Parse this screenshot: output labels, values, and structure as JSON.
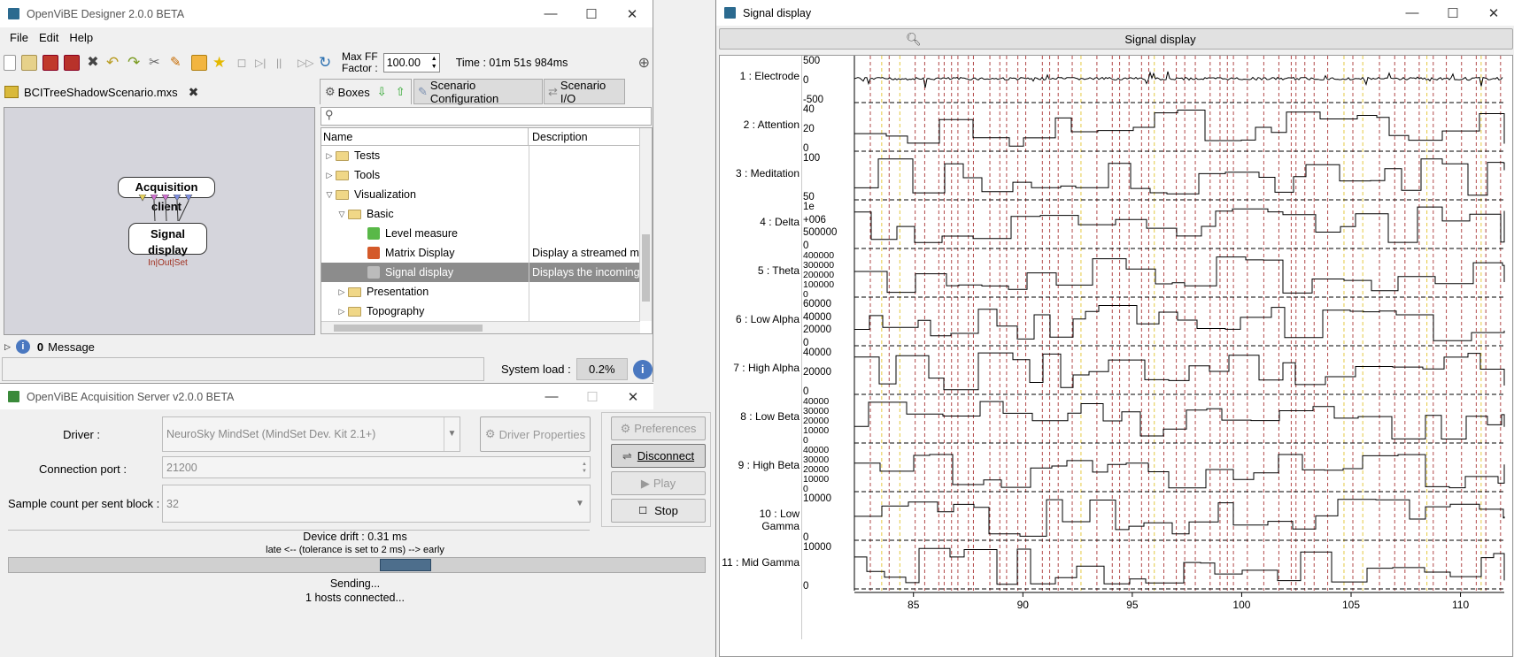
{
  "designer": {
    "title": "OpenViBE Designer 2.0.0 BETA",
    "menu": [
      "File",
      "Edit",
      "Help"
    ],
    "maxff_label1": "Max FF",
    "maxff_label2": "Factor :",
    "maxff_value": "100.00",
    "time": "Time : 01m 51s 984ms",
    "scenario_tab": "BCITreeShadowScenario.mxs",
    "box_acq": "Acquisition client",
    "box_sig": "Signal display",
    "box_sig_sub": "In|Out|Set",
    "tabs": [
      "Boxes",
      "Scenario Configuration",
      "Scenario I/O"
    ],
    "col_name": "Name",
    "col_desc": "Description",
    "tree": [
      {
        "label": "Tests",
        "level": 0,
        "arrow": "▷",
        "folder": true,
        "desc": ""
      },
      {
        "label": "Tools",
        "level": 0,
        "arrow": "▷",
        "folder": true,
        "desc": ""
      },
      {
        "label": "Visualization",
        "level": 0,
        "arrow": "▽",
        "folder": true,
        "desc": ""
      },
      {
        "label": "Basic",
        "level": 1,
        "arrow": "▽",
        "folder": true,
        "desc": ""
      },
      {
        "label": "Level measure",
        "level": 2,
        "arrow": "",
        "folder": false,
        "desc": ""
      },
      {
        "label": "Matrix Display",
        "level": 2,
        "arrow": "",
        "folder": false,
        "desc": "Display a streamed ma"
      },
      {
        "label": "Signal display",
        "level": 2,
        "arrow": "",
        "folder": false,
        "desc": "Displays the incoming s",
        "selected": true
      },
      {
        "label": "Presentation",
        "level": 1,
        "arrow": "▷",
        "folder": true,
        "desc": ""
      },
      {
        "label": "Topography",
        "level": 1,
        "arrow": "▷",
        "folder": true,
        "desc": ""
      }
    ],
    "message_count": "0",
    "message_label": "Message",
    "sysload_label": "System load :",
    "sysload_value": "0.2%"
  },
  "acq": {
    "title": "OpenViBE Acquisition Server v2.0.0 BETA",
    "driver_label": "Driver :",
    "driver_value": "NeuroSky MindSet (MindSet Dev. Kit 2.1+)",
    "driver_props": "Driver Properties",
    "port_label": "Connection port :",
    "port_value": "21200",
    "sample_label": "Sample count per sent block :",
    "sample_value": "32",
    "preferences": "Preferences",
    "disconnect": "Disconnect",
    "play": "Play",
    "stop": "Stop",
    "drift": "Device drift : 0.31 ms",
    "tolerance": "late <-- (tolerance is set to 2 ms) --> early",
    "drift_fraction": 0.57,
    "status1": "Sending...",
    "status2": "1 hosts connected..."
  },
  "signal": {
    "title": "Signal display",
    "button": "Signal display",
    "channels": [
      {
        "label": "1 : Electrode",
        "ticks": [
          "500",
          "0",
          "-500"
        ]
      },
      {
        "label": "2 : Attention",
        "ticks": [
          "40",
          "20",
          "0"
        ]
      },
      {
        "label": "3 : Meditation",
        "ticks": [
          "100",
          "50"
        ]
      },
      {
        "label": "4 : Delta",
        "ticks": [
          "1e",
          "+006",
          "500000",
          "0"
        ]
      },
      {
        "label": "5 : Theta",
        "ticks": [
          "400000",
          "300000",
          "200000",
          "100000",
          "0"
        ]
      },
      {
        "label": "6 : Low Alpha",
        "ticks": [
          "60000",
          "40000",
          "20000",
          "0"
        ]
      },
      {
        "label": "7 : High Alpha",
        "ticks": [
          "40000",
          "20000",
          "0"
        ]
      },
      {
        "label": "8 : Low Beta",
        "ticks": [
          "40000",
          "30000",
          "20000",
          "10000",
          "0"
        ]
      },
      {
        "label": "9 : High Beta",
        "ticks": [
          "40000",
          "30000",
          "20000",
          "10000",
          "0"
        ]
      },
      {
        "label": "10 : Low Gamma",
        "ticks": [
          "10000",
          "0"
        ]
      },
      {
        "label": "11 : Mid Gamma",
        "ticks": [
          "10000",
          "0"
        ]
      }
    ],
    "x_ticks": [
      "85",
      "90",
      "95",
      "100",
      "105",
      "110"
    ],
    "x_range": [
      82.3,
      112
    ],
    "marker_color": "#a52a2a"
  }
}
